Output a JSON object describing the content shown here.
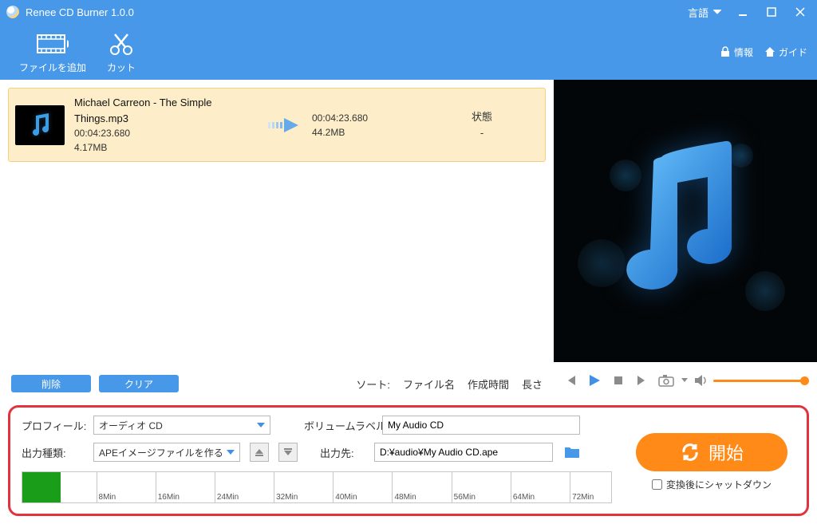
{
  "app": {
    "title": "Renee CD Burner 1.0.0",
    "language_label": "言語"
  },
  "toolbar": {
    "add_file": "ファイルを追加",
    "cut": "カット",
    "info": "情報",
    "guide": "ガイド"
  },
  "filelist": {
    "status_header": "状態",
    "items": [
      {
        "filename": "Michael Carreon - The Simple Things.mp3",
        "src_duration": "00:04:23.680",
        "src_size": "4.17MB",
        "dst_duration": "00:04:23.680",
        "dst_size": "44.2MB",
        "status": "-"
      }
    ],
    "delete_btn": "削除",
    "clear_btn": "クリア",
    "sort_label": "ソート:",
    "sort_options": {
      "name": "ファイル名",
      "created": "作成時間",
      "length": "長さ"
    }
  },
  "settings": {
    "profile_label": "プロフィール:",
    "profile_value": "オーディオ CD",
    "volume_label": "ボリュームラベル:",
    "volume_value": "My Audio CD",
    "output_type_label": "出力種類:",
    "output_type_value": "APEイメージファイルを作る",
    "output_path_label": "出力先:",
    "output_path_value": "D:¥audio¥My Audio CD.ape",
    "timeline_ticks": [
      "8Min",
      "16Min",
      "24Min",
      "32Min",
      "40Min",
      "48Min",
      "56Min",
      "64Min",
      "72Min"
    ],
    "start_btn": "開始",
    "shutdown_label": "変換後にシャットダウン"
  }
}
